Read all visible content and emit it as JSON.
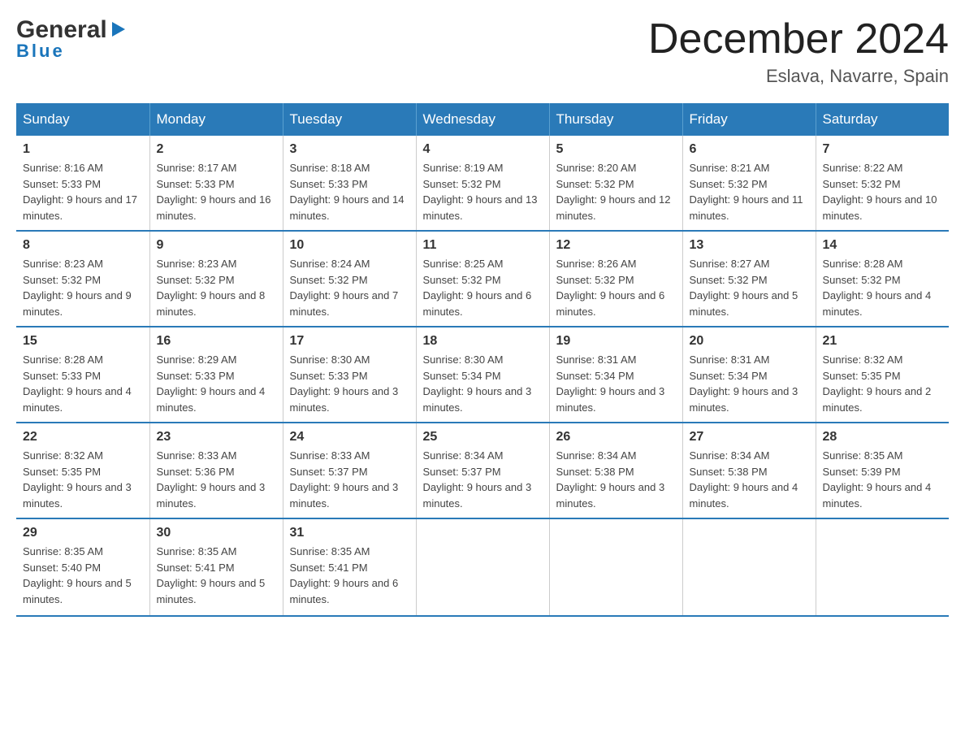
{
  "logo": {
    "line1": "General",
    "arrow": "▶",
    "line2": "Blue"
  },
  "title": "December 2024",
  "subtitle": "Eslava, Navarre, Spain",
  "days_of_week": [
    "Sunday",
    "Monday",
    "Tuesday",
    "Wednesday",
    "Thursday",
    "Friday",
    "Saturday"
  ],
  "weeks": [
    [
      {
        "num": "1",
        "sunrise": "8:16 AM",
        "sunset": "5:33 PM",
        "daylight": "9 hours and 17 minutes."
      },
      {
        "num": "2",
        "sunrise": "8:17 AM",
        "sunset": "5:33 PM",
        "daylight": "9 hours and 16 minutes."
      },
      {
        "num": "3",
        "sunrise": "8:18 AM",
        "sunset": "5:33 PM",
        "daylight": "9 hours and 14 minutes."
      },
      {
        "num": "4",
        "sunrise": "8:19 AM",
        "sunset": "5:32 PM",
        "daylight": "9 hours and 13 minutes."
      },
      {
        "num": "5",
        "sunrise": "8:20 AM",
        "sunset": "5:32 PM",
        "daylight": "9 hours and 12 minutes."
      },
      {
        "num": "6",
        "sunrise": "8:21 AM",
        "sunset": "5:32 PM",
        "daylight": "9 hours and 11 minutes."
      },
      {
        "num": "7",
        "sunrise": "8:22 AM",
        "sunset": "5:32 PM",
        "daylight": "9 hours and 10 minutes."
      }
    ],
    [
      {
        "num": "8",
        "sunrise": "8:23 AM",
        "sunset": "5:32 PM",
        "daylight": "9 hours and 9 minutes."
      },
      {
        "num": "9",
        "sunrise": "8:23 AM",
        "sunset": "5:32 PM",
        "daylight": "9 hours and 8 minutes."
      },
      {
        "num": "10",
        "sunrise": "8:24 AM",
        "sunset": "5:32 PM",
        "daylight": "9 hours and 7 minutes."
      },
      {
        "num": "11",
        "sunrise": "8:25 AM",
        "sunset": "5:32 PM",
        "daylight": "9 hours and 6 minutes."
      },
      {
        "num": "12",
        "sunrise": "8:26 AM",
        "sunset": "5:32 PM",
        "daylight": "9 hours and 6 minutes."
      },
      {
        "num": "13",
        "sunrise": "8:27 AM",
        "sunset": "5:32 PM",
        "daylight": "9 hours and 5 minutes."
      },
      {
        "num": "14",
        "sunrise": "8:28 AM",
        "sunset": "5:32 PM",
        "daylight": "9 hours and 4 minutes."
      }
    ],
    [
      {
        "num": "15",
        "sunrise": "8:28 AM",
        "sunset": "5:33 PM",
        "daylight": "9 hours and 4 minutes."
      },
      {
        "num": "16",
        "sunrise": "8:29 AM",
        "sunset": "5:33 PM",
        "daylight": "9 hours and 4 minutes."
      },
      {
        "num": "17",
        "sunrise": "8:30 AM",
        "sunset": "5:33 PM",
        "daylight": "9 hours and 3 minutes."
      },
      {
        "num": "18",
        "sunrise": "8:30 AM",
        "sunset": "5:34 PM",
        "daylight": "9 hours and 3 minutes."
      },
      {
        "num": "19",
        "sunrise": "8:31 AM",
        "sunset": "5:34 PM",
        "daylight": "9 hours and 3 minutes."
      },
      {
        "num": "20",
        "sunrise": "8:31 AM",
        "sunset": "5:34 PM",
        "daylight": "9 hours and 3 minutes."
      },
      {
        "num": "21",
        "sunrise": "8:32 AM",
        "sunset": "5:35 PM",
        "daylight": "9 hours and 2 minutes."
      }
    ],
    [
      {
        "num": "22",
        "sunrise": "8:32 AM",
        "sunset": "5:35 PM",
        "daylight": "9 hours and 3 minutes."
      },
      {
        "num": "23",
        "sunrise": "8:33 AM",
        "sunset": "5:36 PM",
        "daylight": "9 hours and 3 minutes."
      },
      {
        "num": "24",
        "sunrise": "8:33 AM",
        "sunset": "5:37 PM",
        "daylight": "9 hours and 3 minutes."
      },
      {
        "num": "25",
        "sunrise": "8:34 AM",
        "sunset": "5:37 PM",
        "daylight": "9 hours and 3 minutes."
      },
      {
        "num": "26",
        "sunrise": "8:34 AM",
        "sunset": "5:38 PM",
        "daylight": "9 hours and 3 minutes."
      },
      {
        "num": "27",
        "sunrise": "8:34 AM",
        "sunset": "5:38 PM",
        "daylight": "9 hours and 4 minutes."
      },
      {
        "num": "28",
        "sunrise": "8:35 AM",
        "sunset": "5:39 PM",
        "daylight": "9 hours and 4 minutes."
      }
    ],
    [
      {
        "num": "29",
        "sunrise": "8:35 AM",
        "sunset": "5:40 PM",
        "daylight": "9 hours and 5 minutes."
      },
      {
        "num": "30",
        "sunrise": "8:35 AM",
        "sunset": "5:41 PM",
        "daylight": "9 hours and 5 minutes."
      },
      {
        "num": "31",
        "sunrise": "8:35 AM",
        "sunset": "5:41 PM",
        "daylight": "9 hours and 6 minutes."
      },
      null,
      null,
      null,
      null
    ]
  ]
}
